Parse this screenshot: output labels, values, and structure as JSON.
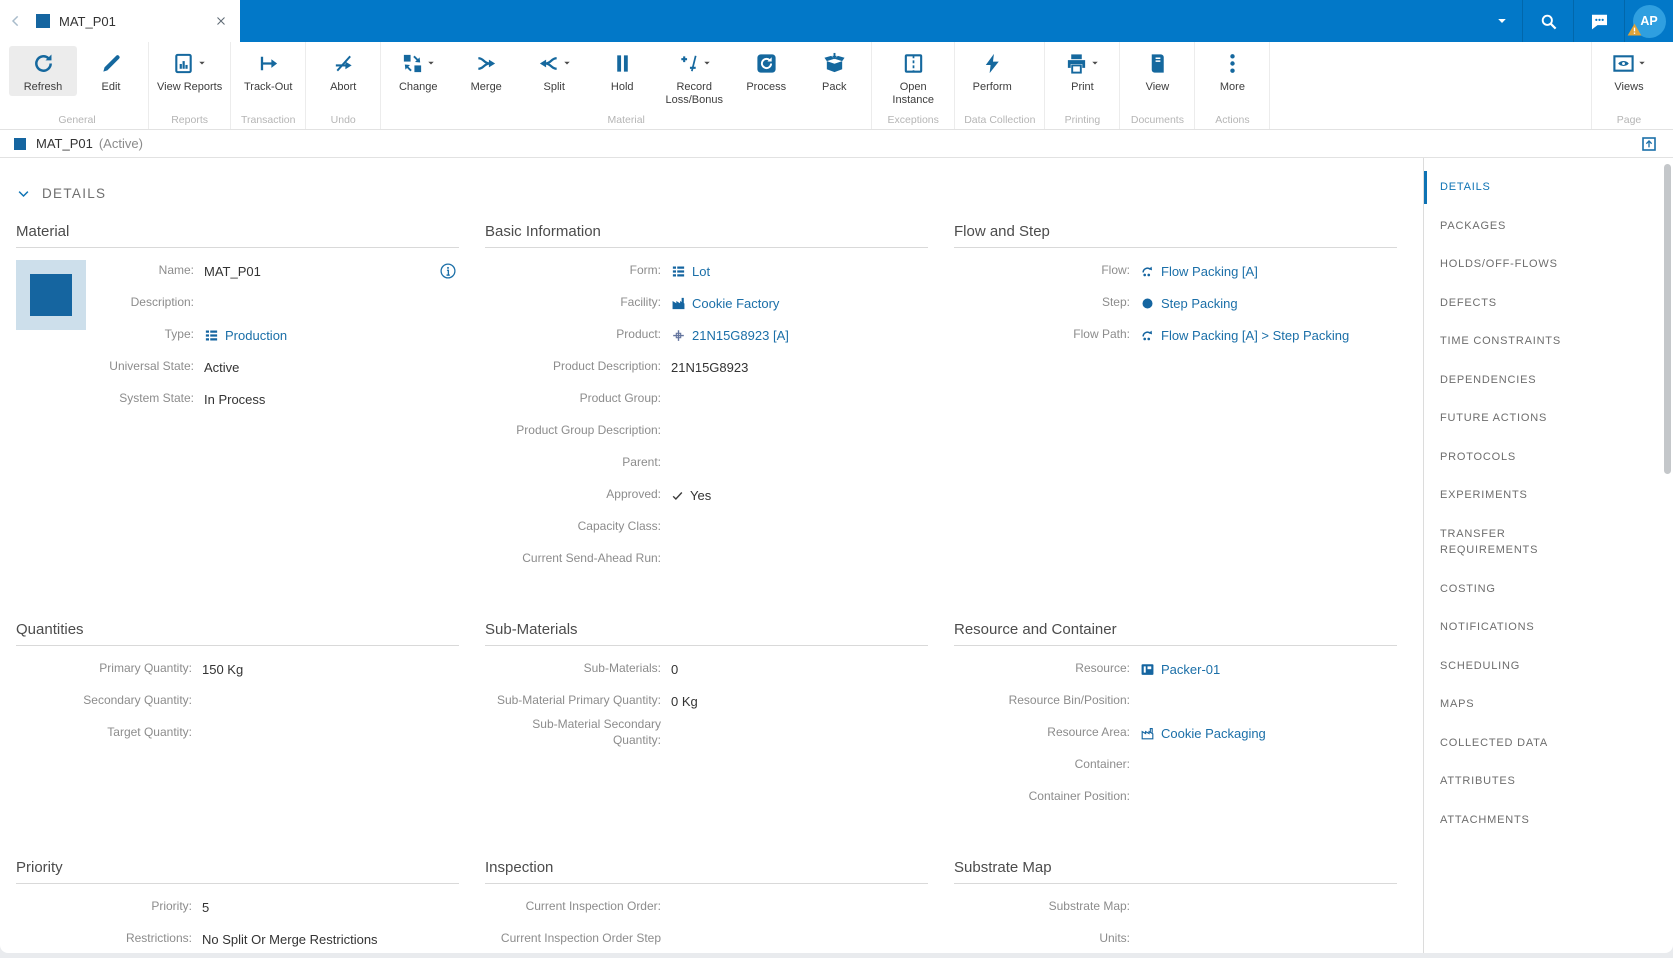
{
  "colors": {
    "topbar_blue": "#0278c8",
    "toolbar_icon_blue": "#15689e",
    "link_blue": "#1b6fa8",
    "active_nav_blue": "#0e73b4",
    "material_square_blue": "#1565a0",
    "avatar_blue": "#2f9fe0",
    "warning_orange": "#dfa338"
  },
  "topbar": {
    "tab": {
      "title": "MAT_P01"
    },
    "avatar": {
      "initials": "AP"
    }
  },
  "ribbon": {
    "groups": [
      {
        "label": "General",
        "buttons": [
          {
            "label": "Refresh",
            "icon": "refresh",
            "active": true
          },
          {
            "label": "Edit",
            "icon": "edit"
          }
        ]
      },
      {
        "label": "Reports",
        "buttons": [
          {
            "label": "View Reports",
            "icon": "report",
            "caret": true
          }
        ]
      },
      {
        "label": "Transaction",
        "buttons": [
          {
            "label": "Track-Out",
            "icon": "track-out"
          }
        ]
      },
      {
        "label": "Undo",
        "buttons": [
          {
            "label": "Abort",
            "icon": "abort"
          }
        ]
      },
      {
        "label": "Material",
        "buttons": [
          {
            "label": "Change",
            "icon": "change",
            "caret": true
          },
          {
            "label": "Merge",
            "icon": "merge"
          },
          {
            "label": "Split",
            "icon": "split",
            "caret": true
          },
          {
            "label": "Hold",
            "icon": "hold"
          },
          {
            "label": "Record Loss/Bonus",
            "icon": "loss-bonus",
            "caret": true
          },
          {
            "label": "Process",
            "icon": "process"
          },
          {
            "label": "Pack",
            "icon": "pack"
          }
        ]
      },
      {
        "label": "Exceptions",
        "buttons": [
          {
            "label": "Open Instance",
            "icon": "open-instance"
          }
        ]
      },
      {
        "label": "Data Collection",
        "buttons": [
          {
            "label": "Perform",
            "icon": "perform"
          }
        ]
      },
      {
        "label": "Printing",
        "buttons": [
          {
            "label": "Print",
            "icon": "print",
            "caret": true
          }
        ]
      },
      {
        "label": "Documents",
        "buttons": [
          {
            "label": "View",
            "icon": "view-doc"
          }
        ]
      },
      {
        "label": "Actions",
        "buttons": [
          {
            "label": "More",
            "icon": "more"
          }
        ]
      },
      {
        "label": "Page",
        "align": "right",
        "buttons": [
          {
            "label": "Views",
            "icon": "views",
            "caret": true
          }
        ]
      }
    ]
  },
  "breadcrumb": {
    "title": "MAT_P01",
    "state": "(Active)"
  },
  "details_header": "DETAILS",
  "bands": [
    [
      {
        "title": "Material",
        "thumb": true,
        "label_width": 100,
        "rows": [
          {
            "label": "Name:",
            "value": "MAT_P01",
            "info": true
          },
          {
            "label": "Description:",
            "value": ""
          },
          {
            "label": "Type:",
            "value": "Production",
            "link": true,
            "icon": "list"
          },
          {
            "label": "Universal State:",
            "value": "Active"
          },
          {
            "label": "System State:",
            "value": "In Process"
          }
        ]
      },
      {
        "title": "Basic Information",
        "rows": [
          {
            "label": "Form:",
            "value": "Lot",
            "link": true,
            "icon": "list"
          },
          {
            "label": "Facility:",
            "value": "Cookie Factory",
            "link": true,
            "icon": "factory"
          },
          {
            "label": "Product:",
            "value": "21N15G8923 [A]",
            "link": true,
            "icon": "product"
          },
          {
            "label": "Product Description:",
            "value": "21N15G8923"
          },
          {
            "label": "Product Group:",
            "value": ""
          },
          {
            "label": "Product Group Description:",
            "value": ""
          },
          {
            "label": "Parent:",
            "value": ""
          },
          {
            "label": "Approved:",
            "value": "Yes",
            "check": true
          },
          {
            "label": "Capacity Class:",
            "value": ""
          },
          {
            "label": "Current Send-Ahead Run:",
            "value": ""
          }
        ]
      },
      {
        "title": "Flow and Step",
        "rows": [
          {
            "label": "Flow:",
            "value": "Flow Packing [A]",
            "link": true,
            "icon": "flow"
          },
          {
            "label": "Step:",
            "value": "Step Packing",
            "link": true,
            "icon": "step"
          },
          {
            "label": "Flow Path:",
            "value": "Flow Packing [A] > Step Packing",
            "link": true,
            "icon": "flow"
          }
        ]
      }
    ],
    [
      {
        "title": "Quantities",
        "rows": [
          {
            "label": "Primary Quantity:",
            "value": "150 Kg"
          },
          {
            "label": "Secondary Quantity:",
            "value": ""
          },
          {
            "label": "Target Quantity:",
            "value": ""
          }
        ]
      },
      {
        "title": "Sub-Materials",
        "rows": [
          {
            "label": "Sub-Materials:",
            "value": "0"
          },
          {
            "label": "Sub-Material Primary Quantity:",
            "value": "0 Kg"
          },
          {
            "label": "Sub-Material Secondary Quantity:",
            "value": ""
          }
        ]
      },
      {
        "title": "Resource and Container",
        "rows": [
          {
            "label": "Resource:",
            "value": "Packer-01",
            "link": true,
            "icon": "resource"
          },
          {
            "label": "Resource Bin/Position:",
            "value": ""
          },
          {
            "label": "Resource Area:",
            "value": "Cookie Packaging",
            "link": true,
            "icon": "factory-outline"
          },
          {
            "label": "Container:",
            "value": ""
          },
          {
            "label": "Container Position:",
            "value": ""
          }
        ]
      }
    ],
    [
      {
        "title": "Priority",
        "rows": [
          {
            "label": "Priority:",
            "value": "5"
          },
          {
            "label": "Restrictions:",
            "value": "No Split Or Merge Restrictions"
          }
        ]
      },
      {
        "title": "Inspection",
        "rows": [
          {
            "label": "Current Inspection Order:",
            "value": ""
          },
          {
            "label": "Current Inspection Order Step",
            "value": ""
          }
        ]
      },
      {
        "title": "Substrate Map",
        "rows": [
          {
            "label": "Substrate Map:",
            "value": ""
          },
          {
            "label": "Units:",
            "value": ""
          }
        ]
      }
    ]
  ],
  "sidebar": {
    "items": [
      {
        "label": "DETAILS",
        "active": true
      },
      {
        "label": "PACKAGES"
      },
      {
        "label": "HOLDS/OFF-FLOWS"
      },
      {
        "label": "DEFECTS"
      },
      {
        "label": "TIME CONSTRAINTS"
      },
      {
        "label": "DEPENDENCIES"
      },
      {
        "label": "FUTURE ACTIONS"
      },
      {
        "label": "PROTOCOLS"
      },
      {
        "label": "EXPERIMENTS"
      },
      {
        "label": "TRANSFER REQUIREMENTS"
      },
      {
        "label": "COSTING"
      },
      {
        "label": "NOTIFICATIONS"
      },
      {
        "label": "SCHEDULING"
      },
      {
        "label": "MAPS"
      },
      {
        "label": "COLLECTED DATA"
      },
      {
        "label": "ATTRIBUTES"
      },
      {
        "label": "ATTACHMENTS"
      }
    ]
  }
}
